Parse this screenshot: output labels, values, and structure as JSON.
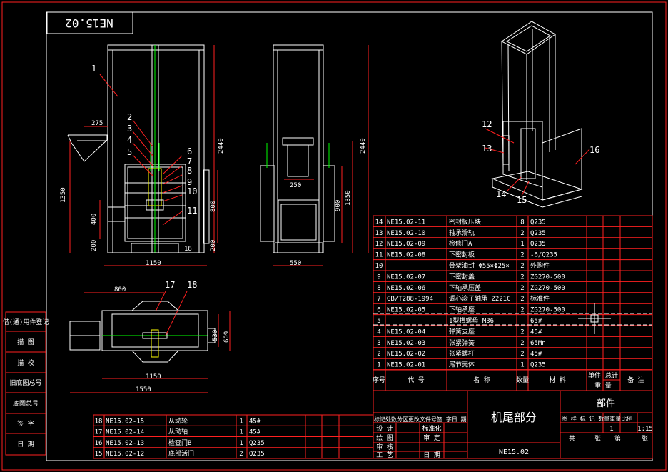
{
  "drawing_code_box": "NE15.02",
  "side_stamp": [
    "借(通)用件登记",
    "描 图",
    "描 校",
    "旧底图总号",
    "底图总号",
    "签 字",
    "日 期"
  ],
  "callouts": [
    "1",
    "2",
    "3",
    "4",
    "5",
    "6",
    "7",
    "8",
    "9",
    "10",
    "11",
    "12",
    "13",
    "14",
    "15",
    "16",
    "17",
    "18"
  ],
  "dims": {
    "front_275": "275",
    "front_2440": "2440",
    "front_1350": "1350",
    "front_400": "400",
    "front_200a": "200",
    "front_1150": "1150",
    "front_800": "800",
    "front_200b": "200",
    "front_18": "18",
    "side_2440": "2440",
    "side_250": "250",
    "side_1350": "1350",
    "side_900": "900",
    "side_550": "550",
    "plan_800": "800",
    "plan_1150": "1150",
    "plan_1550": "1550",
    "plan_530": "530",
    "plan_609": "609"
  },
  "bom_header": [
    "序号",
    "代 号",
    "名 称",
    "数量",
    "材 料",
    "单件",
    "总计",
    "备 注"
  ],
  "bom_header_sub": "重 量",
  "bom_rows": [
    [
      "14",
      "NE15.02-11",
      "密封板压块",
      "8",
      "Q235",
      ""
    ],
    [
      "13",
      "NE15.02-10",
      "轴承滑轨",
      "2",
      "Q235",
      ""
    ],
    [
      "12",
      "NE15.02-09",
      "检修门A",
      "1",
      "Q235",
      ""
    ],
    [
      "11",
      "NE15.02-08",
      "下密封板",
      "2",
      "-6/Q235",
      ""
    ],
    [
      "10",
      "",
      "骨架油封 Φ55×Φ25×",
      "2",
      "外购件",
      ""
    ],
    [
      "9",
      "NE15.02-07",
      "下密封盖",
      "2",
      "ZG270-500",
      ""
    ],
    [
      "8",
      "NE15.02-06",
      "下轴承压盖",
      "2",
      "ZG270-500",
      ""
    ],
    [
      "7",
      "GB/T288-1994",
      "调心滚子轴承 2221C",
      "2",
      "标准件",
      ""
    ],
    [
      "6",
      "NE15.02-05",
      "下轴承座",
      "2",
      "ZG270-500",
      ""
    ],
    [
      "5",
      "",
      "1型槽螺母 M36",
      "",
      "65#",
      ""
    ],
    [
      "4",
      "NE15.02-04",
      "弹簧支座",
      "2",
      "45#",
      ""
    ],
    [
      "3",
      "NE15.02-03",
      "张紧弹簧",
      "2",
      "65Mn",
      ""
    ],
    [
      "2",
      "NE15.02-02",
      "张紧螺杆",
      "2",
      "45#",
      ""
    ],
    [
      "1",
      "NE15.02-01",
      "尾节壳体",
      "1",
      "Q235",
      ""
    ]
  ],
  "bom2_rows": [
    [
      "18",
      "NE15.02-15",
      "从动轮",
      "1",
      "45#"
    ],
    [
      "17",
      "NE15.02-14",
      "从动轴",
      "1",
      "45#"
    ],
    [
      "16",
      "NE15.02-13",
      "检查门B",
      "1",
      "Q235"
    ],
    [
      "15",
      "NE15.02-12",
      "底部活门",
      "2",
      "Q235"
    ]
  ],
  "title_block": {
    "revision_header": "标记处数分区更改文件号签 字日 期",
    "roles": [
      "设 计",
      "绘 图",
      "审 核",
      "工 艺"
    ],
    "roles2": [
      "标准化",
      "审 定",
      "",
      "日 期"
    ],
    "part_name": "机尾部分",
    "category": "部件",
    "drawing_no": "NE15.02",
    "stage_header": "图 样 标 记 数量重量比例",
    "qty": "1",
    "scale": "1:15",
    "sheet_footer": [
      "共",
      "张",
      "第",
      "张"
    ]
  }
}
